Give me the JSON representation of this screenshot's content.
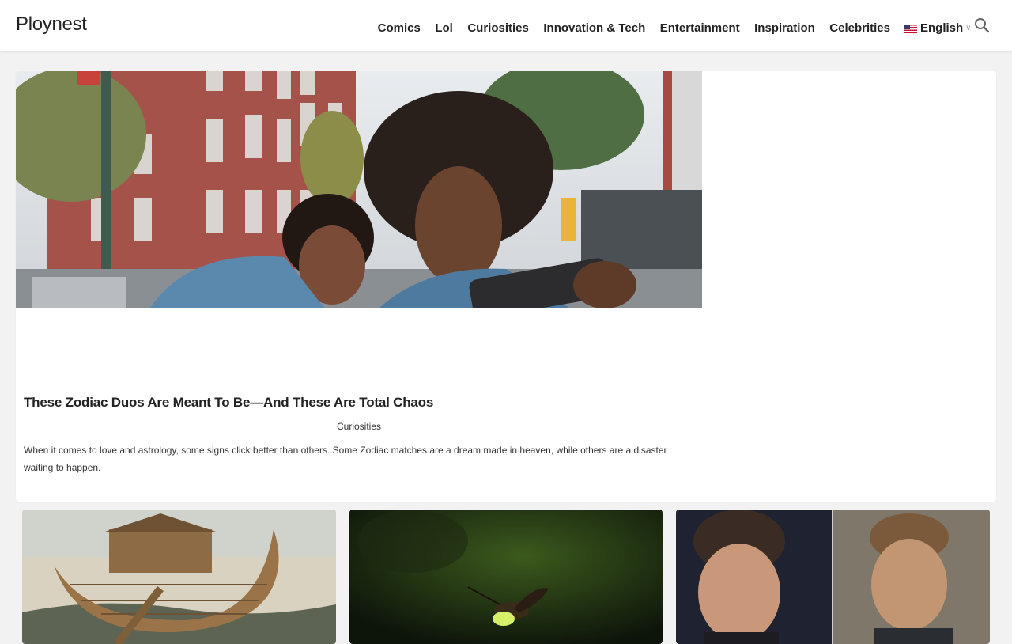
{
  "site": {
    "logo": "Ploynest"
  },
  "nav": {
    "items": [
      {
        "label": "Comics"
      },
      {
        "label": "Lol"
      },
      {
        "label": "Curiosities"
      },
      {
        "label": "Innovation & Tech"
      },
      {
        "label": "Entertainment"
      },
      {
        "label": "Inspiration"
      },
      {
        "label": "Celebrities"
      }
    ],
    "language": {
      "label": "English",
      "flag": "us-flag-icon"
    },
    "search_icon": "search-icon"
  },
  "featured": {
    "image": "two-people-taking-selfie-photo",
    "title": "These Zodiac Duos Are Meant To Be—And These Are Total Chaos",
    "category": "Curiosities",
    "excerpt": "When it comes to love and astrology, some signs click better than others. Some Zodiac matches are a dream made in heaven, while others are a disaster waiting to happen."
  },
  "cards": [
    {
      "image": "noahs-ark-painting"
    },
    {
      "image": "firefly-macro-photo"
    },
    {
      "image": "two-actors-split-photo"
    }
  ],
  "colors": {
    "background": "#f2f2f2",
    "header": "#ffffff",
    "text": "#222222"
  }
}
